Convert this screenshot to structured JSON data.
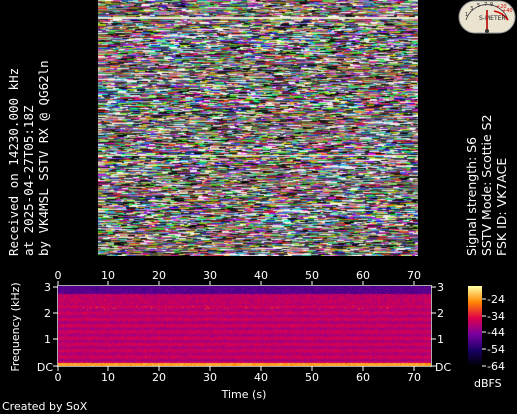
{
  "left_caption": {
    "line1": "Received on  14230.000 kHz",
    "line2": "at 2025-04-27T05:18Z",
    "line3": "by VK4MSL SSTV RX @ QG62ln"
  },
  "right_caption": {
    "line1": "Signal strength: S6",
    "line2": "SSTV Mode: Scottie S2",
    "line3": "FSK ID: VK7ACE"
  },
  "s_meter": {
    "reading": "S6",
    "scale_labels": [
      "1",
      "3",
      "5",
      "7",
      "9",
      "+20",
      "+40",
      "+60"
    ],
    "label": "S-METER"
  },
  "spectrogram": {
    "x_ticks": [
      "0",
      "10",
      "20",
      "30",
      "40",
      "50",
      "60",
      "70"
    ],
    "x_label": "Time (s)",
    "y_ticks_left": [
      "3",
      "2",
      "1",
      "DC"
    ],
    "y_ticks_right": [
      "3",
      "2",
      "1",
      "DC"
    ],
    "y_label": "Frequency (kHz)",
    "colorbar_ticks": [
      "-24",
      "-34",
      "-44",
      "-54",
      "-64"
    ],
    "colorbar_label": "dBFS"
  },
  "footer": {
    "credit": "Created by SoX"
  }
}
